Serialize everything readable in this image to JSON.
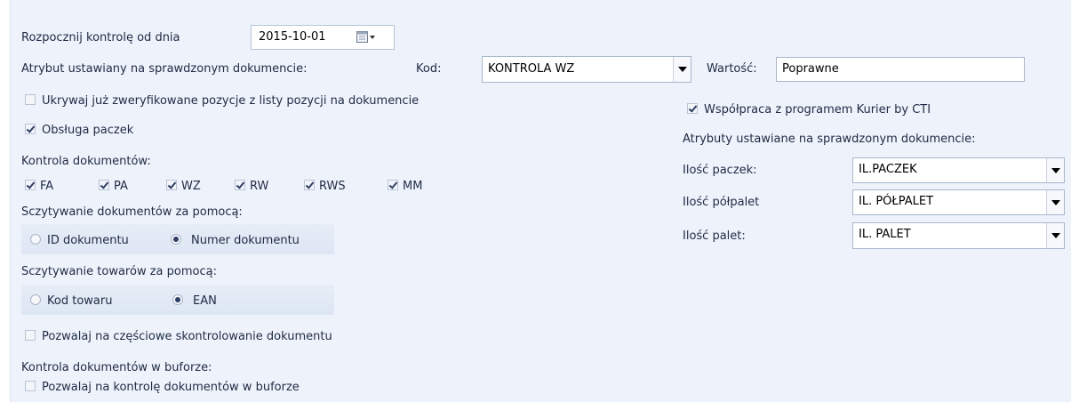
{
  "start": {
    "label": "Rozpocznij kontrolę od dnia",
    "date": "2015-10-01"
  },
  "attribute": {
    "label": "Atrybut ustawiany na sprawdzonym dokumencie:",
    "kod_label": "Kod:",
    "kod_value": "KONTROLA WZ",
    "wartosc_label": "Wartość:",
    "wartosc_value": "Poprawne"
  },
  "hide_verified": {
    "label": "Ukrywaj już zweryfikowane pozycje z listy pozycji na dokumencie",
    "checked": false
  },
  "parcels": {
    "label": "Obsługa paczek",
    "checked": true
  },
  "doc_control": {
    "label": "Kontrola dokumentów:",
    "types": [
      {
        "label": "FA",
        "checked": true
      },
      {
        "label": "PA",
        "checked": true
      },
      {
        "label": "WZ",
        "checked": true
      },
      {
        "label": "RW",
        "checked": true
      },
      {
        "label": "RWS",
        "checked": true
      },
      {
        "label": "MM",
        "checked": true
      }
    ]
  },
  "doc_scan": {
    "label": "Sczytywanie dokumentów za pomocą:",
    "options": [
      "ID dokumentu",
      "Numer dokumentu"
    ],
    "selected": "Numer dokumentu"
  },
  "goods_scan": {
    "label": "Sczytywanie towarów za pomocą:",
    "options": [
      "Kod towaru",
      "EAN"
    ],
    "selected": "EAN"
  },
  "partial": {
    "label": "Pozwalaj na częściowe skontrolowanie dokumentu",
    "checked": false
  },
  "buffer": {
    "label": "Kontrola dokumentów w buforze:",
    "option_label": "Pozwalaj na kontrolę dokumentów w buforze",
    "checked": false
  },
  "courier": {
    "label": "Współpraca z programem Kurier by CTI",
    "checked": true,
    "attrs_label": "Atrybuty ustawiane na sprawdzonym dokumencie:",
    "rows": [
      {
        "label": "Ilość paczek:",
        "value": "IL.PACZEK"
      },
      {
        "label": "Ilość półpalet",
        "value": "IL. PÓŁPALET"
      },
      {
        "label": "Ilość palet:",
        "value": "IL. PALET"
      }
    ]
  }
}
